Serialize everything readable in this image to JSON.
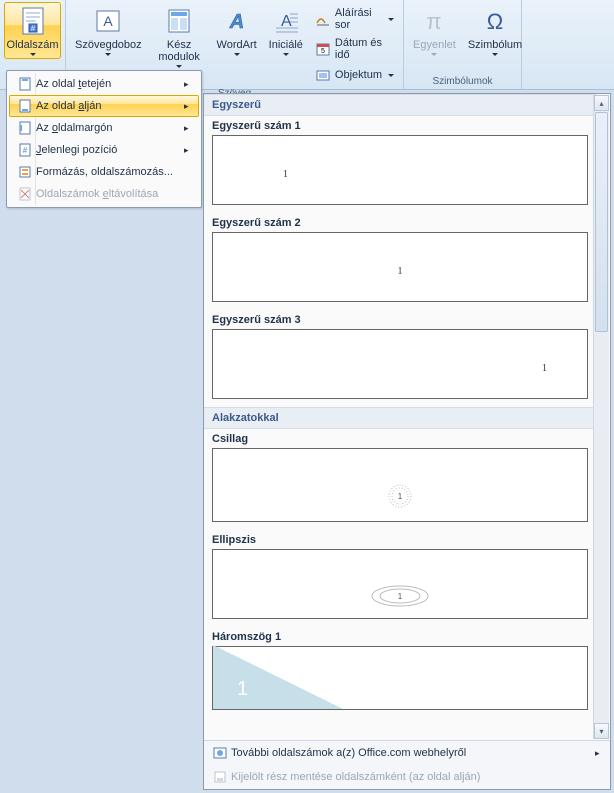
{
  "ribbon": {
    "oldalszam": "Oldalszám",
    "szovegdoboz": "Szövegdoboz",
    "kesz_modulok": "Kész modulok",
    "wordart": "WordArt",
    "inicialek": "Iniciálé",
    "alairasi_sor": "Aláírási sor",
    "datum_ido": "Dátum és idő",
    "objektum": "Objektum",
    "egyenlet": "Egyenlet",
    "szimbolum": "Szimbólum",
    "group_szoveg": "Szöveg",
    "group_szimbolumok": "Szimbólumok"
  },
  "menu": {
    "top": "Az oldal tetején",
    "bottom": "Az oldal alján",
    "margin": "Az oldalmargón",
    "current": "Jelenlegi pozíció",
    "format": "Formázás, oldalszámozás...",
    "remove": "Oldalszámok eltávolítása",
    "top_accel": "t",
    "bottom_accel": "a",
    "margin_accel": "o",
    "current_accel": "J",
    "remove_accel": "e"
  },
  "gallery": {
    "section1": "Egyszerű",
    "item1": "Egyszerű szám 1",
    "item2": "Egyszerű szám 2",
    "item3": "Egyszerű szám 3",
    "section2": "Alakzatokkal",
    "item4": "Csillag",
    "item5": "Ellipszis",
    "item6": "Háromszög 1",
    "page_number": "1",
    "footer_more": "További oldalszámok a(z) Office.com webhelyről",
    "footer_save": "Kijelölt rész mentése oldalszámként (az oldal alján)"
  },
  "chart_data": null
}
